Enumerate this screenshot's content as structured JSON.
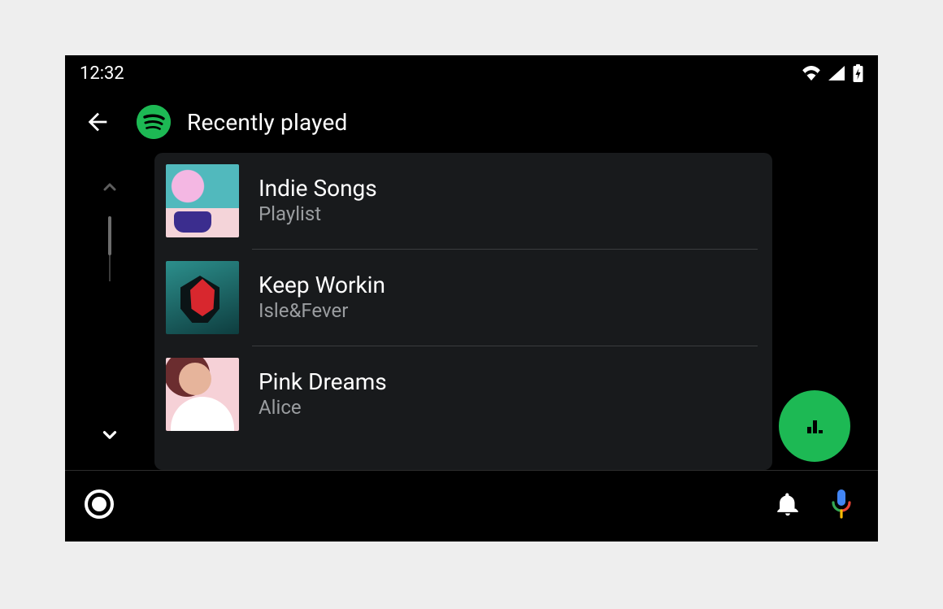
{
  "status": {
    "time": "12:32"
  },
  "header": {
    "title": "Recently played"
  },
  "list": [
    {
      "title": "Indie Songs",
      "subtitle": "Playlist"
    },
    {
      "title": "Keep Workin",
      "subtitle": "Isle&Fever"
    },
    {
      "title": "Pink Dreams",
      "subtitle": "Alice"
    }
  ],
  "colors": {
    "accent": "#1db954"
  }
}
